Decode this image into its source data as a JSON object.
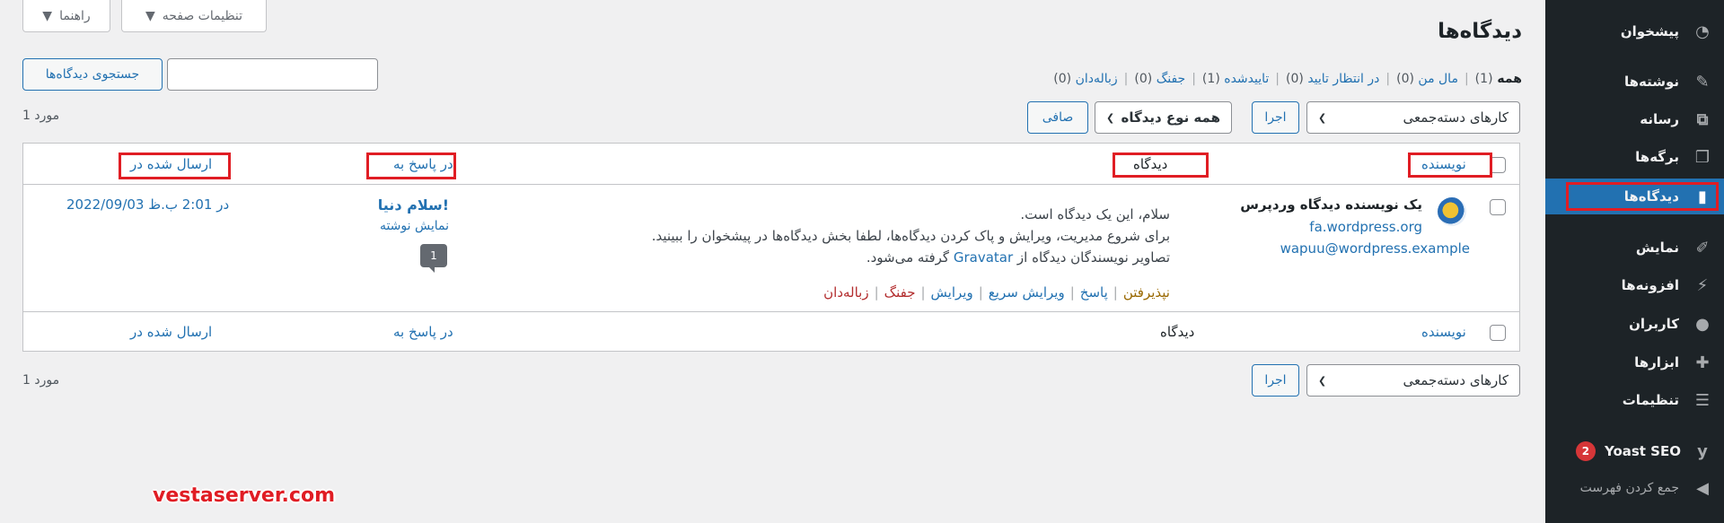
{
  "colors": {
    "accent": "#2271b1",
    "sidebar": "#1d2327",
    "highlight": "#e01d24",
    "badge": "#d63638"
  },
  "screen_meta": {
    "screen_options": "تنظیمات صفحه",
    "help": "راهنما"
  },
  "sidebar": {
    "items": [
      {
        "label": "پیشخوان",
        "icon": "dashboard-icon"
      },
      {
        "label": "نوشته‌ها",
        "icon": "pin-icon"
      },
      {
        "label": "رسانه",
        "icon": "media-icon"
      },
      {
        "label": "برگه‌ها",
        "icon": "pages-icon"
      },
      {
        "label": "دیدگاه‌ها",
        "icon": "comments-icon"
      },
      {
        "label": "نمایش",
        "icon": "appearance-icon"
      },
      {
        "label": "افزونه‌ها",
        "icon": "plugins-icon"
      },
      {
        "label": "کاربران",
        "icon": "users-icon"
      },
      {
        "label": "ابزارها",
        "icon": "tools-icon"
      },
      {
        "label": "تنظیمات",
        "icon": "settings-icon"
      },
      {
        "label": "Yoast SEO",
        "icon": "yoast-icon",
        "badge": "2"
      },
      {
        "label": "جمع کردن فهرست",
        "icon": "collapse-icon"
      }
    ]
  },
  "page": {
    "title": "دیدگاه‌ها"
  },
  "filters": {
    "all": "همه",
    "all_count": "(1)",
    "mine": "مال من",
    "mine_count": "(0)",
    "pending": "در انتظار تایید",
    "pending_count": "(0)",
    "approved": "تاییدشده",
    "approved_count": "(1)",
    "spam": "جفنگ",
    "spam_count": "(0)",
    "trash": "زباله‌دان",
    "trash_count": "(0)"
  },
  "search": {
    "button": "جستجوی دیدگاه‌ها",
    "placeholder": ""
  },
  "bulk": {
    "label": "کارهای دسته‌جمعی",
    "apply": "اجرا",
    "type_filter": "همه نوع دیدگاه",
    "filter_button": "صافی"
  },
  "items_count": "1 مورد",
  "table": {
    "headers": {
      "author": "نویسنده",
      "comment": "دیدگاه",
      "response": "در پاسخ به",
      "submitted": "ارسال شده در"
    },
    "row": {
      "author_name": "یک نویسنده دیدگاه وردپرس",
      "author_url": "fa.wordpress.org",
      "author_email": "wapuu@wordpress.example",
      "line1": "سلام، این یک دیدگاه است.",
      "line2": "برای شروع مدیریت، ویرایش و پاک کردن دیدگاه‌ها، لطفا بخش دیدگاه‌ها در پیشخوان را ببینید.",
      "line3_pre": "تصاویر نویسندگان دیدگاه از",
      "line3_link": "Gravatar",
      "line3_post": "گرفته می‌شود.",
      "actions": {
        "approve": "نپذیرفتن",
        "reply": "پاسخ",
        "quick_edit": "ویرایش سریع",
        "edit": "ویرایش",
        "spam": "جفنگ",
        "trash": "زباله‌دان"
      },
      "post_title": "سلام دنیا!",
      "view_post": "نمایش نوشته",
      "comment_count": "1",
      "date": "2022/09/03 در 2:01 ب.ظ"
    }
  },
  "watermark": "vestaserver.com"
}
